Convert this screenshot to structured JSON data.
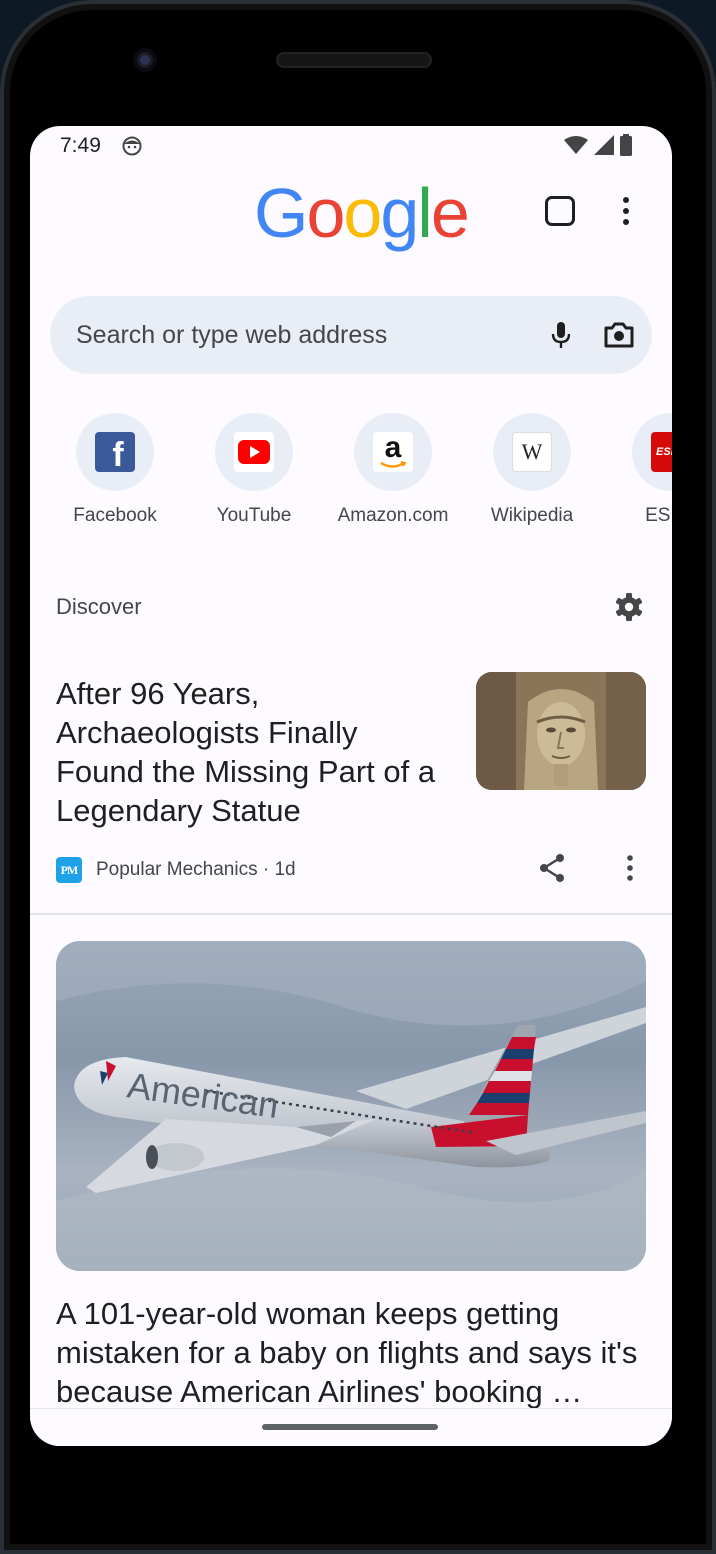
{
  "status_bar": {
    "time": "7:49"
  },
  "header": {
    "logo_letters": [
      {
        "char": "G",
        "color": "#4285f4"
      },
      {
        "char": "o",
        "color": "#ea4335"
      },
      {
        "char": "o",
        "color": "#fbbc05"
      },
      {
        "char": "g",
        "color": "#4285f4"
      },
      {
        "char": "l",
        "color": "#34a853"
      },
      {
        "char": "e",
        "color": "#ea4335"
      }
    ]
  },
  "search": {
    "placeholder": "Search or type web address"
  },
  "shortcuts": [
    {
      "label": "Facebook",
      "icon": "facebook-icon",
      "color": "#3b5998"
    },
    {
      "label": "YouTube",
      "icon": "youtube-icon",
      "color": "#ff0000"
    },
    {
      "label": "Amazon.com",
      "icon": "amazon-icon",
      "color": "#000000"
    },
    {
      "label": "Wikipedia",
      "icon": "wikipedia-icon",
      "color": "#ffffff"
    },
    {
      "label": "ESPN",
      "icon": "espn-icon",
      "color": "#d50a0a"
    }
  ],
  "discover": {
    "label": "Discover",
    "articles": [
      {
        "title": "After 96 Years, Archaeologists Finally Found the Missing Part of a Legendary Statue",
        "source": "Popular Mechanics · 1d",
        "source_logo": "PM"
      },
      {
        "title": "A 101-year-old woman keeps getting mistaken for a baby on flights and says it's because American Airlines' booking …",
        "image_text": "American"
      }
    ]
  }
}
